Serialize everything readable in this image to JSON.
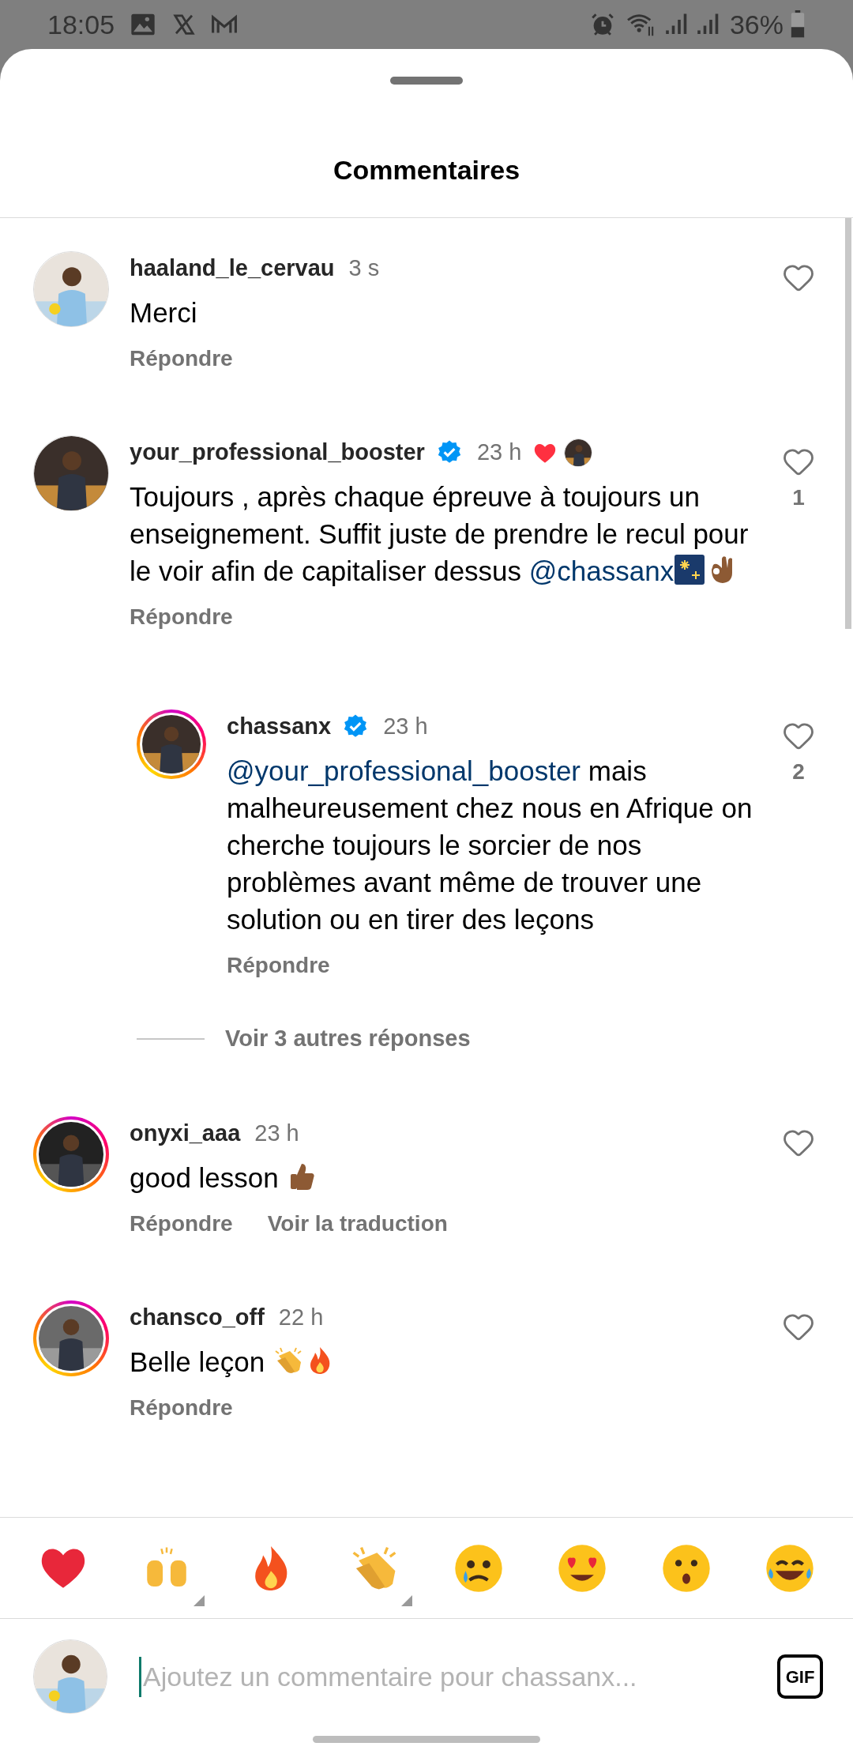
{
  "status_bar": {
    "time": "18:05",
    "battery": "36%"
  },
  "header": {
    "title": "Commentaires"
  },
  "comments": [
    {
      "username": "haaland_le_cervau",
      "verified": false,
      "time": "3 s",
      "author_liked": false,
      "story_ring": false,
      "parts": [
        {
          "kind": "text",
          "text": "Merci"
        }
      ],
      "liked": false,
      "reply": "Répondre"
    },
    {
      "username": "your_professional_booster",
      "verified": true,
      "time": "23 h",
      "author_liked": true,
      "story_ring": false,
      "parts": [
        {
          "kind": "text",
          "text": "Toujours , après chaque épreuve à toujours un enseignement. Suffit juste de prendre le recul pour le voir afin de capitaliser dessus "
        },
        {
          "kind": "mention",
          "text": "@chassanx"
        },
        {
          "kind": "fireworks"
        },
        {
          "kind": "ok-hand"
        }
      ],
      "liked": false,
      "likes": "1",
      "reply": "Répondre",
      "replies": [
        {
          "username": "chassanx",
          "verified": true,
          "time": "23 h",
          "author_liked": false,
          "story_ring": true,
          "parts": [
            {
              "kind": "mention",
              "text": "@your_professional_booster"
            },
            {
              "kind": "text",
              "text": " mais malheureusement chez nous en Afrique on cherche toujours le sorcier de nos problèmes avant même de trouver une solution ou en tirer des leçons"
            }
          ],
          "liked": false,
          "likes": "2",
          "reply": "Répondre"
        }
      ],
      "more_replies": "Voir 3 autres réponses"
    },
    {
      "username": "onyxi_aaa",
      "verified": false,
      "time": "23 h",
      "author_liked": false,
      "story_ring": true,
      "parts": [
        {
          "kind": "text",
          "text": "good lesson "
        },
        {
          "kind": "thumbs-up"
        }
      ],
      "liked": false,
      "reply": "Répondre",
      "translate": "Voir la traduction"
    },
    {
      "username": "chansco_off",
      "verified": false,
      "time": "22 h",
      "author_liked": false,
      "story_ring": true,
      "parts": [
        {
          "kind": "text",
          "text": "Belle leçon "
        },
        {
          "kind": "clap"
        },
        {
          "kind": "fire"
        }
      ],
      "liked": false,
      "reply": "Répondre"
    }
  ],
  "reactions": [
    {
      "kind": "heart",
      "menu": false
    },
    {
      "kind": "raised-hands",
      "menu": true
    },
    {
      "kind": "fire",
      "menu": false
    },
    {
      "kind": "clap",
      "menu": true
    },
    {
      "kind": "crying",
      "menu": false
    },
    {
      "kind": "heart-eyes",
      "menu": false
    },
    {
      "kind": "surprised",
      "menu": false
    },
    {
      "kind": "tears-of-joy",
      "menu": false
    }
  ],
  "composer": {
    "placeholder": "Ajoutez un commentaire pour chassanx...",
    "gif": "GIF"
  }
}
